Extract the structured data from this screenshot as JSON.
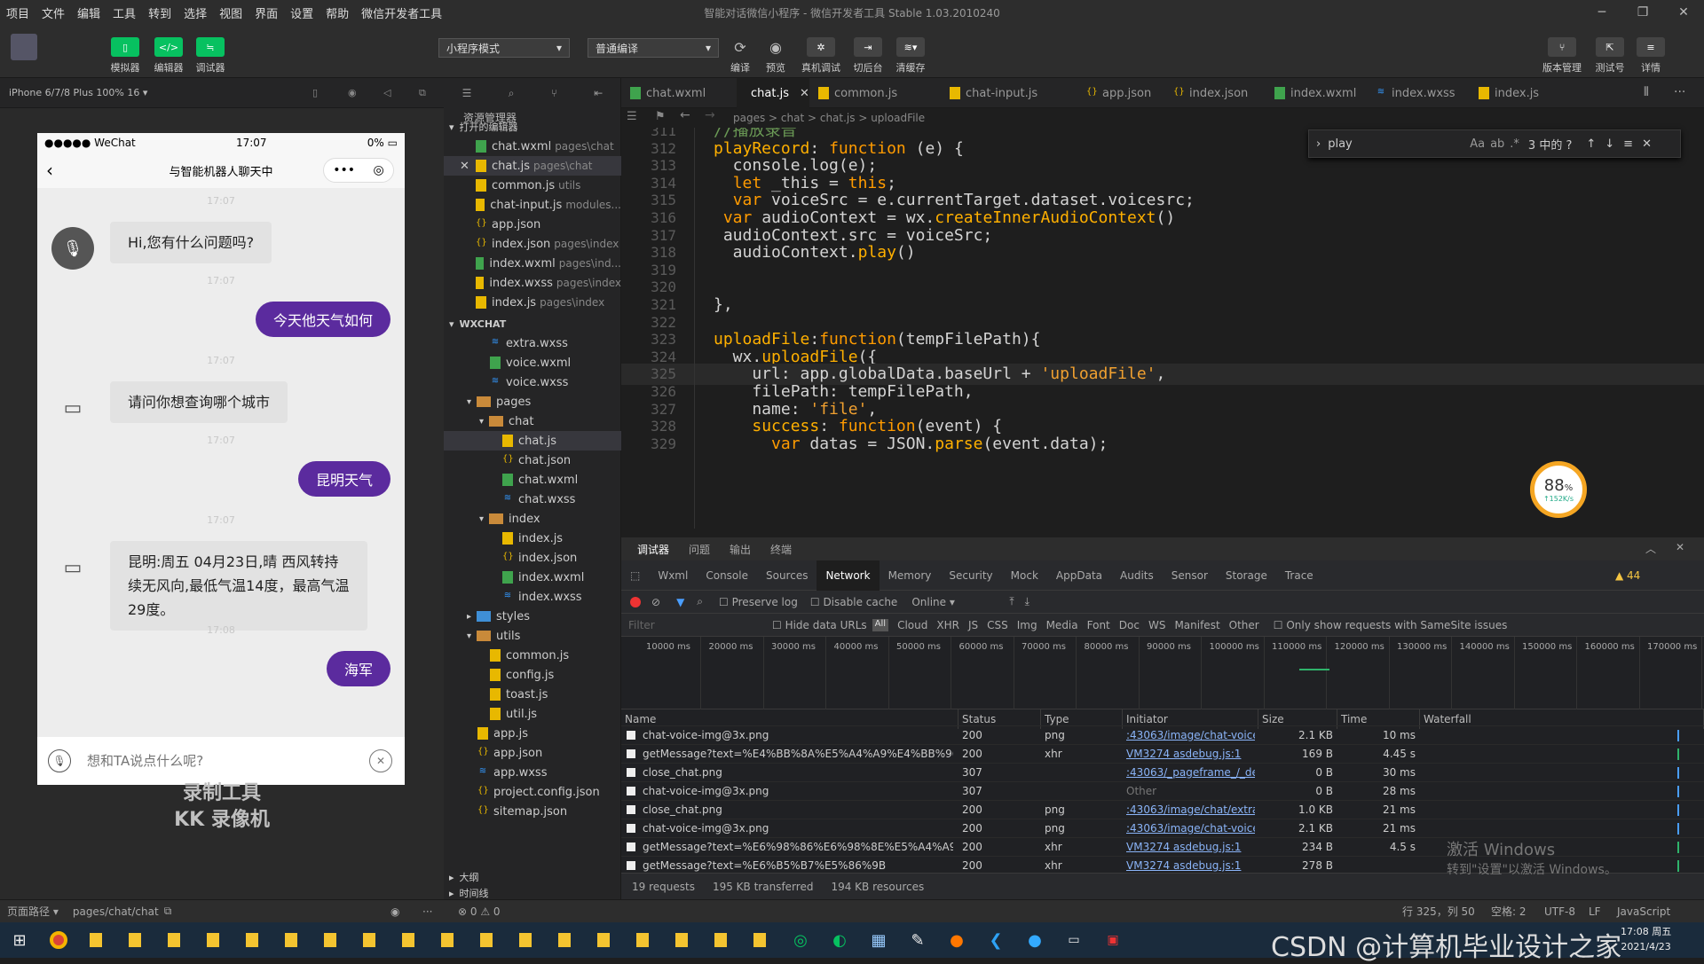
{
  "menubar": {
    "items": [
      "项目",
      "文件",
      "编辑",
      "工具",
      "转到",
      "选择",
      "视图",
      "界面",
      "设置",
      "帮助",
      "微信开发者工具"
    ],
    "title": "智能对话微信小程序 - 微信开发者工具 Stable 1.03.2010240"
  },
  "toolbar": {
    "simulator": "模拟器",
    "editor": "编辑器",
    "debugger": "调试器",
    "mode_select": "小程序模式",
    "compile_select": "普通编译",
    "compile": "编译",
    "preview": "预览",
    "real_debug": "真机调试",
    "background": "切后台",
    "clear_cache": "清缓存",
    "version": "版本管理",
    "test": "测试号",
    "details": "详情"
  },
  "simulator": {
    "device": "iPhone 6/7/8 Plus 100% 16 ▾",
    "status_left": "●●●●● WeChat",
    "status_time": "17:07",
    "status_battery": "0%",
    "nav_title": "与智能机器人聊天中",
    "messages": [
      {
        "time": "17:07",
        "side": "left",
        "text": "Hi,您有什么问题吗?"
      },
      {
        "time": "17:07",
        "side": "right",
        "text": "今天他天气如何"
      },
      {
        "time": "17:07",
        "side": "left",
        "text": "请问你想查询哪个城市"
      },
      {
        "time": "17:07",
        "side": "right",
        "text": "昆明天气"
      },
      {
        "time": "17:07",
        "side": "left",
        "text": "昆明:周五 04月23日,晴 西风转持续无风向,最低气温14度，最高气温29度。"
      },
      {
        "time": "17:08",
        "side": "right",
        "text": "海军"
      }
    ],
    "input_placeholder": "想和TA说点什么呢?",
    "watermark_1": "录制工具",
    "watermark_2": "KK 录像机"
  },
  "explorer": {
    "title": "资源管理器",
    "open_editors": "打开的编辑器",
    "open_files": [
      {
        "name": "chat.wxml",
        "path": "pages\\chat",
        "type": "wxml"
      },
      {
        "name": "chat.js",
        "path": "pages\\chat",
        "type": "js"
      },
      {
        "name": "common.js",
        "path": "utils",
        "type": "js"
      },
      {
        "name": "chat-input.js",
        "path": "modules...",
        "type": "js"
      },
      {
        "name": "app.json",
        "path": "",
        "type": "json"
      },
      {
        "name": "index.json",
        "path": "pages\\index",
        "type": "json"
      },
      {
        "name": "index.wxml",
        "path": "pages\\ind...",
        "type": "wxml"
      },
      {
        "name": "index.wxss",
        "path": "pages\\index",
        "type": "js"
      },
      {
        "name": "index.js",
        "path": "pages\\index",
        "type": "js"
      }
    ],
    "project": "WXCHAT",
    "tree": [
      {
        "name": "extra.wxss",
        "indent": 2,
        "type": "wxss"
      },
      {
        "name": "voice.wxml",
        "indent": 2,
        "type": "wxml"
      },
      {
        "name": "voice.wxss",
        "indent": 2,
        "type": "wxss"
      },
      {
        "name": "pages",
        "indent": 1,
        "type": "folder"
      },
      {
        "name": "chat",
        "indent": 2,
        "type": "folder"
      },
      {
        "name": "chat.js",
        "indent": 3,
        "type": "js"
      },
      {
        "name": "chat.json",
        "indent": 3,
        "type": "json"
      },
      {
        "name": "chat.wxml",
        "indent": 3,
        "type": "wxml"
      },
      {
        "name": "chat.wxss",
        "indent": 3,
        "type": "wxss"
      },
      {
        "name": "index",
        "indent": 2,
        "type": "folder"
      },
      {
        "name": "index.js",
        "indent": 3,
        "type": "js"
      },
      {
        "name": "index.json",
        "indent": 3,
        "type": "json"
      },
      {
        "name": "index.wxml",
        "indent": 3,
        "type": "wxml"
      },
      {
        "name": "index.wxss",
        "indent": 3,
        "type": "wxss"
      },
      {
        "name": "styles",
        "indent": 1,
        "type": "folder-blue"
      },
      {
        "name": "utils",
        "indent": 1,
        "type": "folder"
      },
      {
        "name": "common.js",
        "indent": 2,
        "type": "js"
      },
      {
        "name": "config.js",
        "indent": 2,
        "type": "js"
      },
      {
        "name": "toast.js",
        "indent": 2,
        "type": "js"
      },
      {
        "name": "util.js",
        "indent": 2,
        "type": "js"
      },
      {
        "name": "app.js",
        "indent": 1,
        "type": "js"
      },
      {
        "name": "app.json",
        "indent": 1,
        "type": "json"
      },
      {
        "name": "app.wxss",
        "indent": 1,
        "type": "wxss"
      },
      {
        "name": "project.config.json",
        "indent": 1,
        "type": "json"
      },
      {
        "name": "sitemap.json",
        "indent": 1,
        "type": "json"
      }
    ],
    "outline": "大纲",
    "timeline": "时间线"
  },
  "tabs": [
    {
      "name": "chat.wxml",
      "type": "wxml",
      "active": false
    },
    {
      "name": "chat.js",
      "type": "js",
      "active": true
    },
    {
      "name": "common.js",
      "type": "js",
      "active": false
    },
    {
      "name": "chat-input.js",
      "type": "js",
      "active": false
    },
    {
      "name": "app.json",
      "type": "json",
      "active": false
    },
    {
      "name": "index.json",
      "type": "json",
      "active": false
    },
    {
      "name": "index.wxml",
      "type": "wxml",
      "active": false
    },
    {
      "name": "index.wxss",
      "type": "wxss",
      "active": false
    },
    {
      "name": "index.js",
      "type": "js",
      "active": false
    }
  ],
  "breadcrumb": "pages > chat > chat.js > uploadFile",
  "find": {
    "query": "play",
    "result": "3 中的 ?"
  },
  "code": [
    {
      "ln": "311",
      "text": "//播放录音",
      "cls": "cm",
      "indent": 0
    },
    {
      "ln": "312",
      "text": "playRecord: function (e) {",
      "cls": "",
      "indent": 0
    },
    {
      "ln": "313",
      "text": "  console.log(e);",
      "cls": "",
      "indent": 0
    },
    {
      "ln": "314",
      "text": "  let _this = this;",
      "cls": "",
      "indent": 0
    },
    {
      "ln": "315",
      "text": "  var voiceSrc = e.currentTarget.dataset.voicesrc;",
      "cls": "",
      "indent": 0
    },
    {
      "ln": "316",
      "text": " var audioContext = wx.createInnerAudioContext()",
      "cls": "",
      "indent": 0
    },
    {
      "ln": "317",
      "text": " audioContext.src = voiceSrc;",
      "cls": "",
      "indent": 0
    },
    {
      "ln": "318",
      "text": "  audioContext.play()",
      "cls": "",
      "indent": 0
    },
    {
      "ln": "319",
      "text": "",
      "cls": "",
      "indent": 0
    },
    {
      "ln": "320",
      "text": "",
      "cls": "",
      "indent": 0
    },
    {
      "ln": "321",
      "text": "},",
      "cls": "",
      "indent": 0
    },
    {
      "ln": "322",
      "text": "",
      "cls": "",
      "indent": 0
    },
    {
      "ln": "323",
      "text": "uploadFile:function(tempFilePath){",
      "cls": "",
      "indent": 0
    },
    {
      "ln": "324",
      "text": "  wx.uploadFile({",
      "cls": "",
      "indent": 0
    },
    {
      "ln": "325",
      "text": "    url: app.globalData.baseUrl + 'uploadFile',",
      "cls": "",
      "indent": 0
    },
    {
      "ln": "326",
      "text": "    filePath: tempFilePath,",
      "cls": "",
      "indent": 0
    },
    {
      "ln": "327",
      "text": "    name: 'file',",
      "cls": "",
      "indent": 0
    },
    {
      "ln": "328",
      "text": "    success: function(event) {",
      "cls": "",
      "indent": 0
    },
    {
      "ln": "329",
      "text": "      var datas = JSON.parse(event.data);",
      "cls": "",
      "indent": 0
    }
  ],
  "gauge": {
    "value": "88",
    "unit": "%",
    "speed": "↑152K/s"
  },
  "devtools": {
    "tabs": [
      "调试器",
      "问题",
      "输出",
      "终端"
    ],
    "panels": [
      "Wxml",
      "Console",
      "Sources",
      "Network",
      "Memory",
      "Security",
      "Mock",
      "AppData",
      "Audits",
      "Sensor",
      "Storage",
      "Trace"
    ],
    "active_panel": "Network",
    "warnings": "▲ 44",
    "preserve_log": "Preserve log",
    "disable_cache": "Disable cache",
    "online": "Online",
    "filter_placeholder": "Filter",
    "hide_data_urls": "Hide data URLs",
    "filter_types": [
      "All",
      "Cloud",
      "XHR",
      "JS",
      "CSS",
      "Img",
      "Media",
      "Font",
      "Doc",
      "WS",
      "Manifest",
      "Other"
    ],
    "samesite": "Only show requests with SameSite issues",
    "timeline_ticks": [
      "10000 ms",
      "20000 ms",
      "30000 ms",
      "40000 ms",
      "50000 ms",
      "60000 ms",
      "70000 ms",
      "80000 ms",
      "90000 ms",
      "100000 ms",
      "110000 ms",
      "120000 ms",
      "130000 ms",
      "140000 ms",
      "150000 ms",
      "160000 ms",
      "170000 ms"
    ],
    "columns": [
      "Name",
      "Status",
      "Type",
      "Initiator",
      "Size",
      "Time",
      "Waterfall"
    ],
    "rows": [
      {
        "name": "chat-voice-img@3x.png",
        "status": "200",
        "type": "png",
        "initiator": ":43063/image/chat-voice-img@...",
        "size": "2.1 KB",
        "time": "10 ms"
      },
      {
        "name": "getMessage?text=%E4%BB%8A%E5%A4%A9%E4%BB%96%E5%...",
        "status": "200",
        "type": "xhr",
        "initiator": "VM3274 asdebug.js:1",
        "size": "169 B",
        "time": "4.45 s"
      },
      {
        "name": "close_chat.png",
        "status": "307",
        "type": "",
        "initiator": ":43063/_pageframe_/_dev_/...",
        "size": "0 B",
        "time": "30 ms"
      },
      {
        "name": "chat-voice-img@3x.png",
        "status": "307",
        "type": "",
        "initiator": "Other",
        "size": "0 B",
        "time": "28 ms"
      },
      {
        "name": "close_chat.png",
        "status": "200",
        "type": "png",
        "initiator": ":43063/image/chat/extra/close...",
        "size": "1.0 KB",
        "time": "21 ms"
      },
      {
        "name": "chat-voice-img@3x.png",
        "status": "200",
        "type": "png",
        "initiator": ":43063/image/chat-voice-img@...",
        "size": "2.1 KB",
        "time": "21 ms"
      },
      {
        "name": "getMessage?text=%E6%98%86%E6%98%8E%E5%A4%A9%E6%...",
        "status": "200",
        "type": "xhr",
        "initiator": "VM3274 asdebug.js:1",
        "size": "234 B",
        "time": "4.5 s"
      },
      {
        "name": "getMessage?text=%E6%B5%B7%E5%86%9B",
        "status": "200",
        "type": "xhr",
        "initiator": "VM3274 asdebug.js:1",
        "size": "278 B",
        "time": ""
      }
    ],
    "summary_requests": "19 requests",
    "summary_transferred": "195 KB transferred",
    "summary_resources": "194 KB resources",
    "activate_1": "激活 Windows",
    "activate_2": "转到\"设置\"以激活 Windows。"
  },
  "statusbar": {
    "page_path_label": "页面路径 ▾",
    "page_path": "pages/chat/chat",
    "errors": "⊗ 0 ⚠ 0",
    "position": "行 325，列 50",
    "spaces": "空格: 2",
    "encoding": "UTF-8",
    "eol": "LF",
    "lang": "JavaScript"
  },
  "taskbar": {
    "csdn": "CSDN @计算机毕业设计之家",
    "time": "17:08 周五",
    "date": "2021/4/23"
  }
}
